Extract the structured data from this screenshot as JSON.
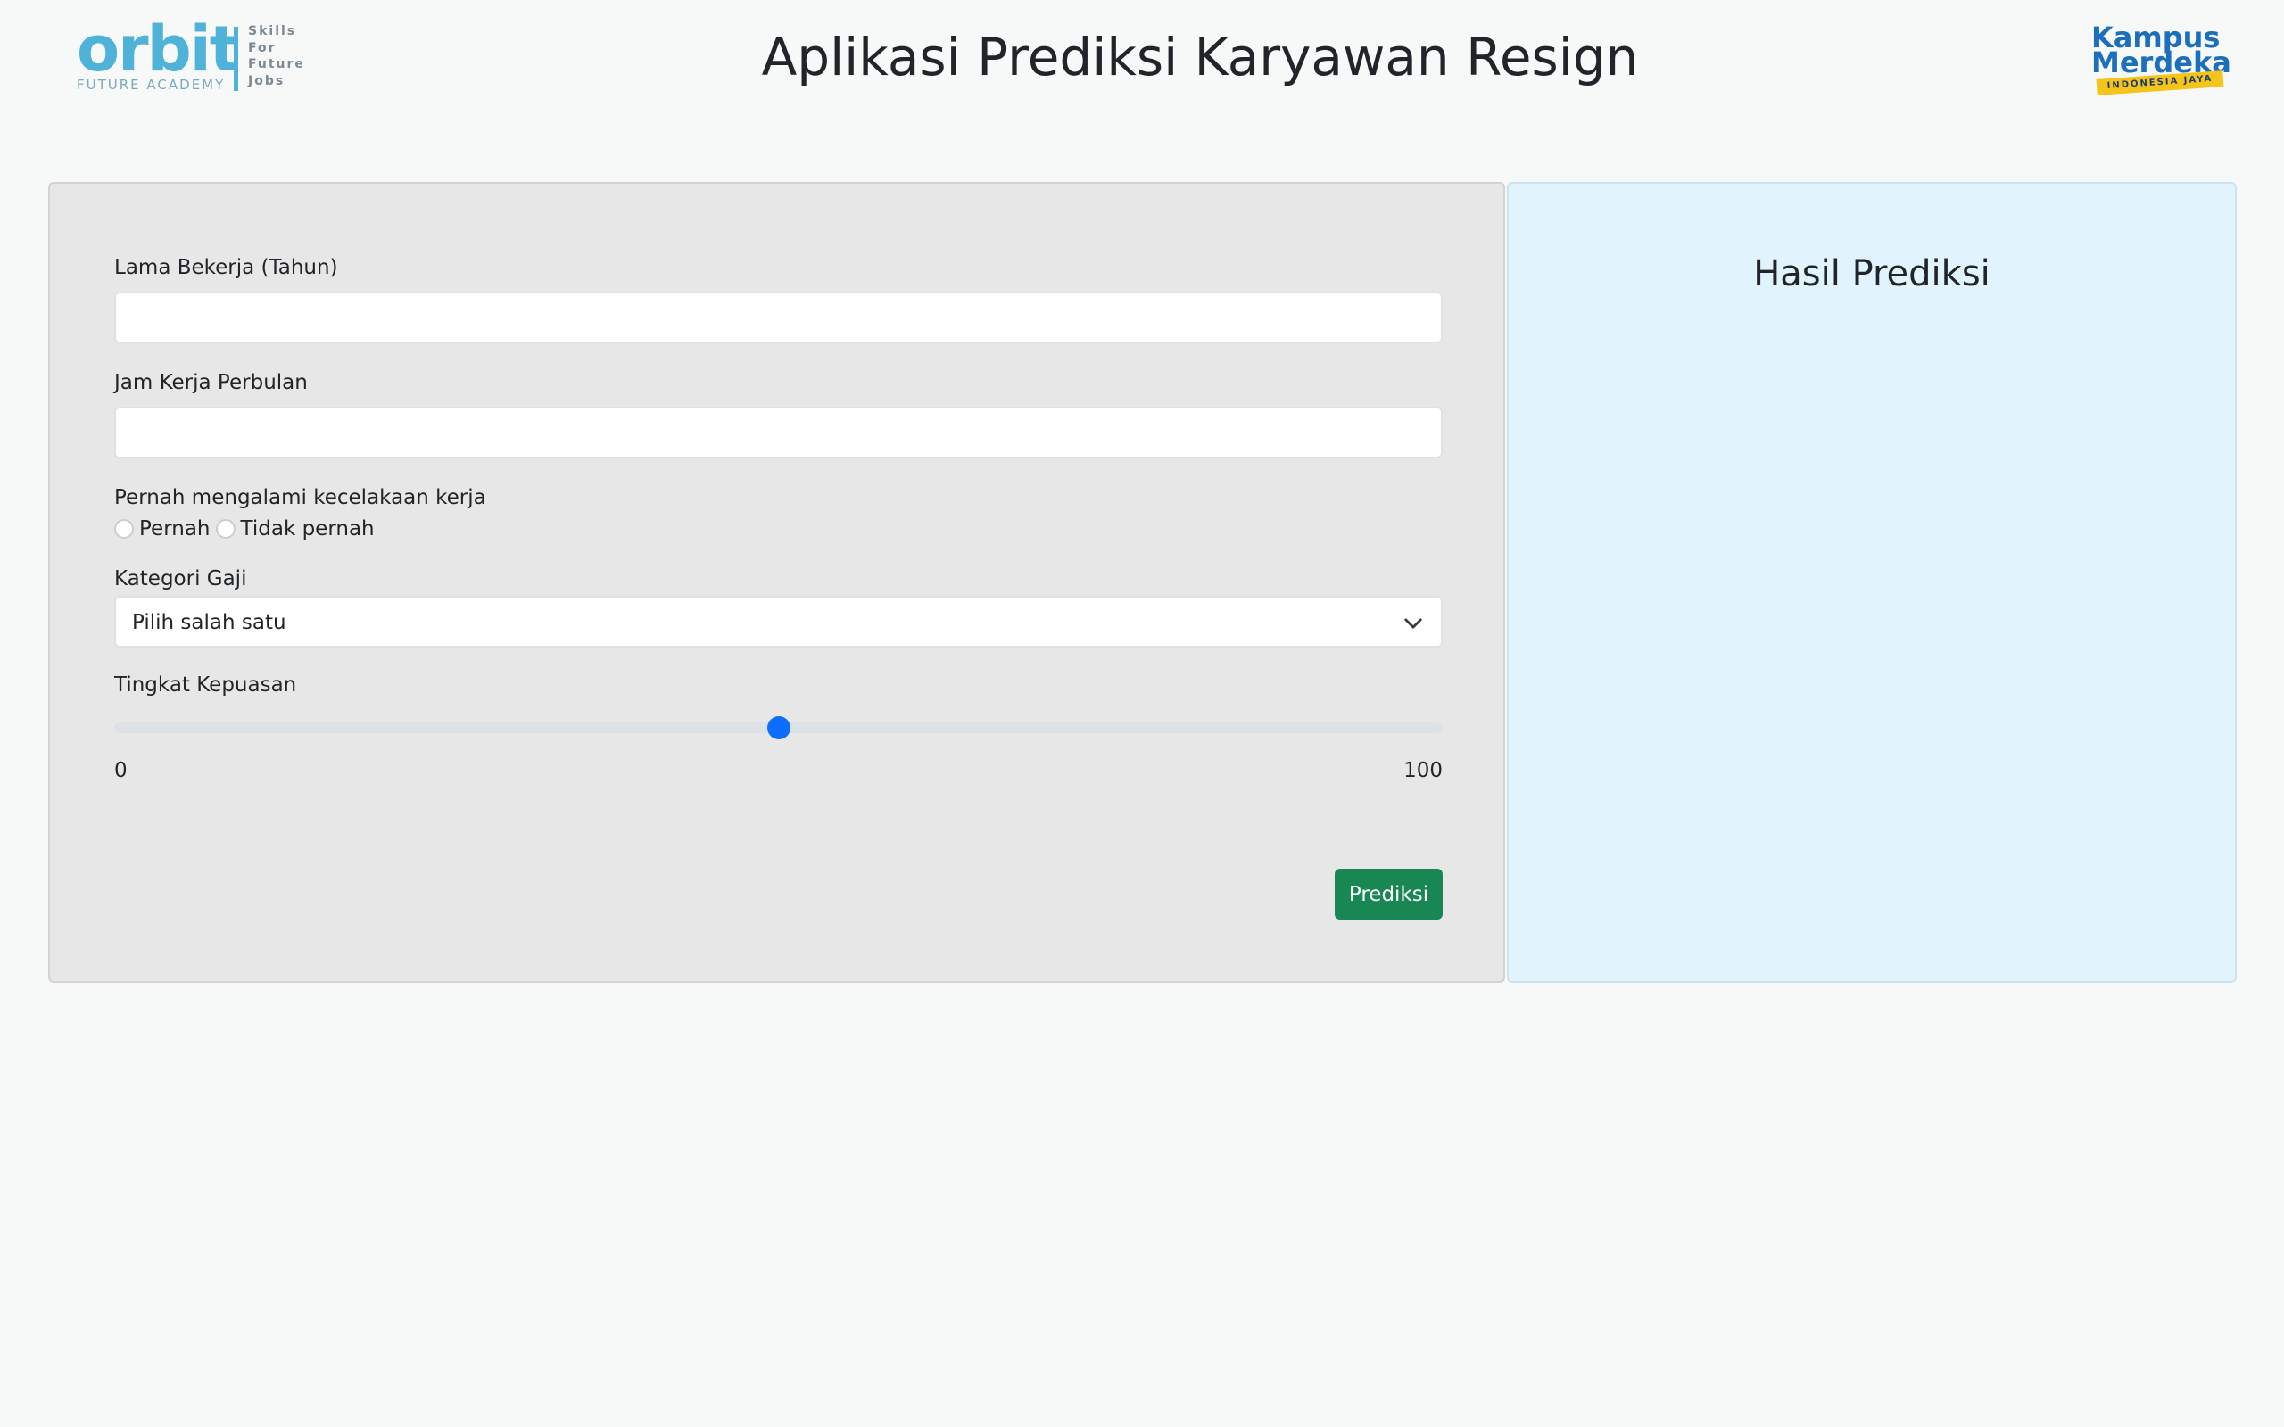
{
  "header": {
    "title": "Aplikasi Prediksi Karyawan Resign",
    "logo_left": {
      "name": "orbit-logo",
      "word": "orbit",
      "subtitle": "FUTURE ACADEMY",
      "tagline": "Skills For Future Jobs"
    },
    "logo_right": {
      "name": "kampus-merdeka-logo",
      "line1": "Kampus",
      "line2": "Merdeka",
      "ribbon": "INDONESIA JAYA"
    }
  },
  "form": {
    "lama_bekerja": {
      "label": "Lama Bekerja (Tahun)",
      "value": "",
      "placeholder": ""
    },
    "jam_kerja": {
      "label": "Jam Kerja Perbulan",
      "value": "",
      "placeholder": ""
    },
    "kecelakaan": {
      "label": "Pernah mengalami kecelakaan kerja",
      "options": [
        "Pernah",
        "Tidak pernah"
      ],
      "selected": null
    },
    "kategori_gaji": {
      "label": "Kategori Gaji",
      "selected": "Pilih salah satu"
    },
    "kepuasan": {
      "label": "Tingkat Kepuasan",
      "min_label": "0",
      "max_label": "100",
      "value": 50,
      "min": 0,
      "max": 100
    },
    "submit_label": "Prediksi"
  },
  "result": {
    "title": "Hasil Prediksi"
  },
  "colors": {
    "accent": "#0d6efd",
    "button": "#198754",
    "result_bg": "#e1f4fd",
    "form_bg": "#e7e7e7"
  },
  "icons": {
    "select": "chevron-down-icon"
  }
}
